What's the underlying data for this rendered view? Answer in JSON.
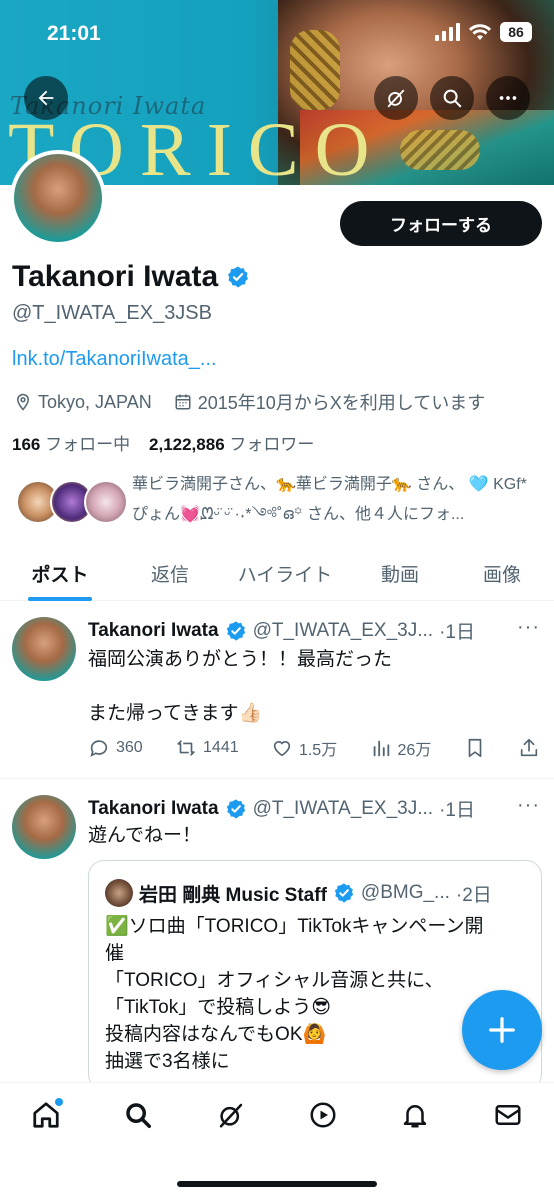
{
  "status_bar": {
    "time": "21:01",
    "battery": "86"
  },
  "banner": {
    "script_text": "Takanori Iwata",
    "title_text": "TORICO"
  },
  "profile": {
    "follow_label": "フォローする",
    "name": "Takanori Iwata",
    "handle": "@T_IWATA_EX_3JSB",
    "link": "lnk.to/TakanoriIwata_...",
    "location": "Tokyo, JAPAN",
    "joined": "2015年10月からXを利用しています",
    "following_count": "166",
    "following_label": "フォロー中",
    "followers_count": "2,122,886",
    "followers_label": "フォロワー",
    "known_followers_text": "華ビラ満開子さん、🐆華ビラ満開子🐆 さん、 🩵 KGf*ぴょん💓ᘻ‪ᵕ̈‬‎ ᵕ̈ ·˖*༺˚ഒ꙳ さん、他４人にフォ..."
  },
  "tabs": [
    "ポスト",
    "返信",
    "ハイライト",
    "動画",
    "画像"
  ],
  "posts": [
    {
      "name": "Takanori Iwata",
      "handle": "@T_IWATA_EX_3J...",
      "time": "·1日",
      "line1": "福岡公演ありがとう！！最高だった",
      "line2": "また帰ってきます👍🏻",
      "replies": "360",
      "reposts": "1441",
      "likes": "1.5万",
      "views": "26万"
    },
    {
      "name": "Takanori Iwata",
      "handle": "@T_IWATA_EX_3J...",
      "time": "·1日",
      "line1": "遊んでねー！",
      "quote": {
        "name": "岩田 剛典 Music Staff",
        "handle": "@BMG_...",
        "time": "·2日",
        "line1": "✅ソロ曲「TORICO」TikTokキャンペーン開",
        "line2": "催",
        "line3": "「TORICO」オフィシャル音源と共に、",
        "line4": "「TikTok」で投稿しよう😎",
        "line5": "投稿内容はなんでもOK🙆",
        "line6": "抽選で3名様に"
      }
    }
  ],
  "icons": {
    "back": "back-arrow-icon",
    "grok": "grok-icon",
    "search": "search-icon",
    "more": "more-icon",
    "fab": "compose-plus-icon"
  },
  "colors": {
    "accent": "#1d9bf0",
    "text": "#0f1419",
    "muted": "#536471"
  }
}
